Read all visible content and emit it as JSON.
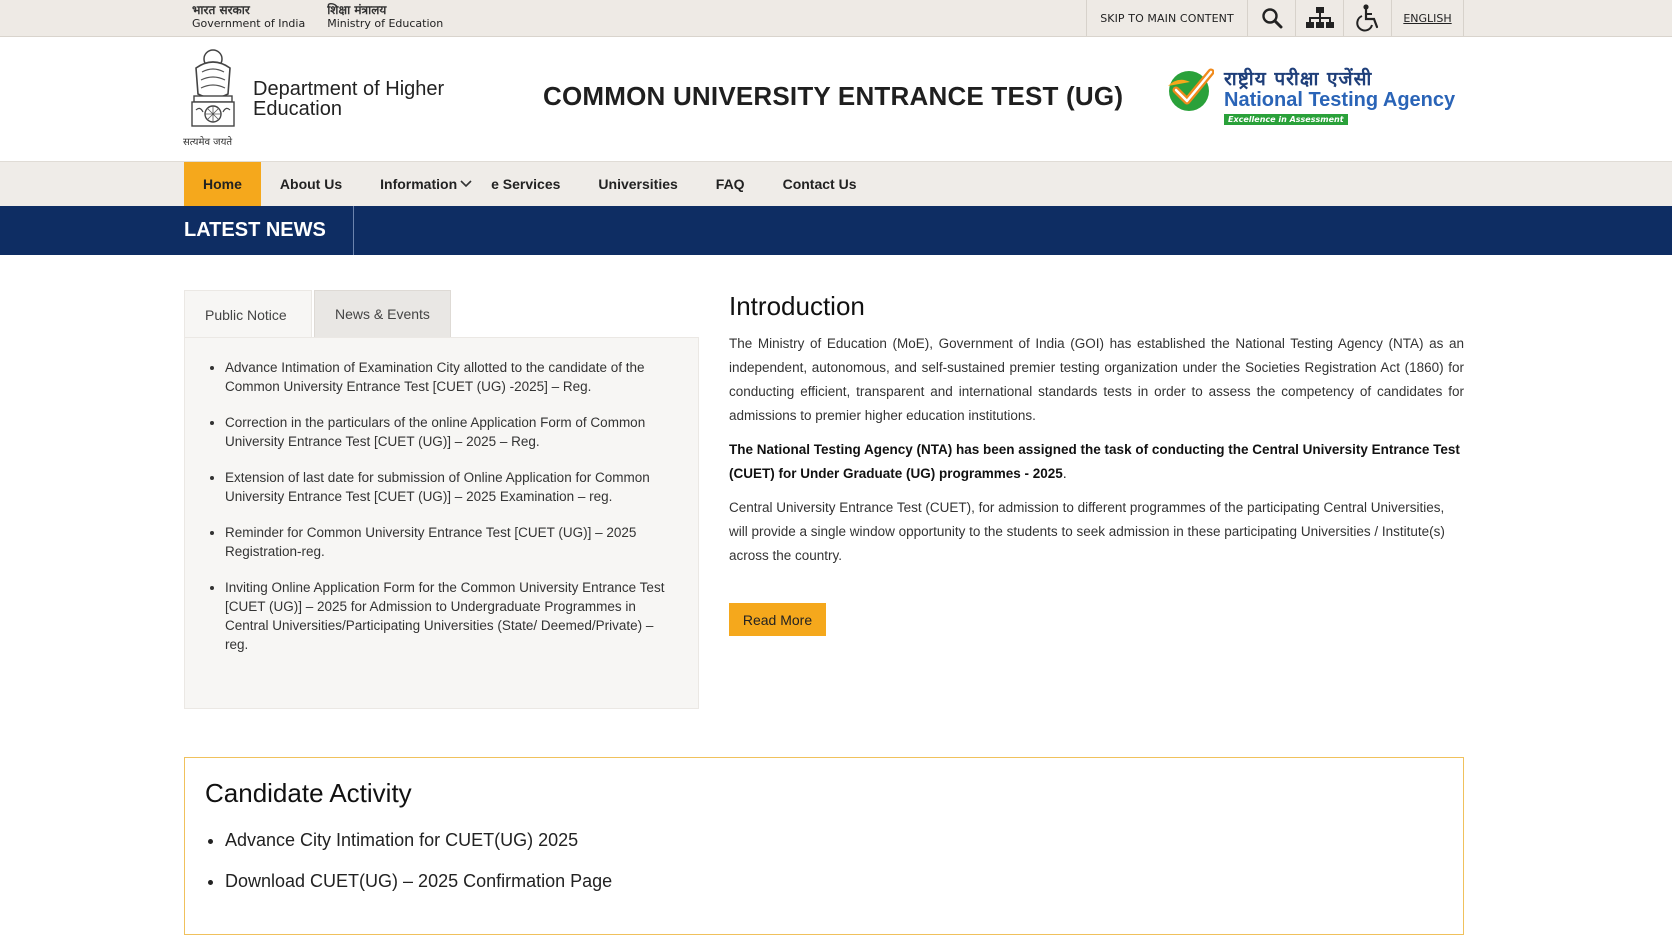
{
  "gov_bar": {
    "gov_hi": "भारत सरकार",
    "gov_en": "Government of India",
    "ministry_hi": "शिक्षा मंत्रालय",
    "ministry_en": "Ministry of Education",
    "skip": "SKIP TO MAIN CONTENT",
    "language": "ENGLISH",
    "icons": [
      "search-icon",
      "sitemap-icon",
      "accessibility-icon"
    ]
  },
  "header": {
    "emblem_caption": "सत्यमेव जयते",
    "department": "Department of Higher Education",
    "title": "COMMON UNIVERSITY ENTRANCE TEST (UG)",
    "nta_hi": "राष्ट्रीय परीक्षा एजेंसी",
    "nta_en": "National Testing Agency",
    "nta_tagline": "Excellence in Assessment"
  },
  "nav": {
    "items": [
      {
        "label": "Home"
      },
      {
        "label": "About Us"
      },
      {
        "label": "Information"
      },
      {
        "label": "e Services"
      },
      {
        "label": "Universities"
      },
      {
        "label": "FAQ"
      },
      {
        "label": "Contact Us"
      }
    ]
  },
  "news_bar": {
    "label": "LATEST NEWS"
  },
  "notices": {
    "tabs": [
      {
        "label": "Public Notice"
      },
      {
        "label": "News & Events"
      }
    ],
    "items": [
      {
        "text": "Advance Intimation of Examination City allotted to the candidate of the Common University Entrance Test [CUET (UG) -2025] – Reg."
      },
      {
        "text": "Correction in the particulars of the online Application Form of Common University Entrance Test [CUET (UG)] – 2025 – Reg."
      },
      {
        "text": "Extension of last date for submission of Online Application for Common University Entrance Test [CUET (UG)] – 2025 Examination – reg."
      },
      {
        "text": "Reminder for Common University Entrance Test [CUET (UG)] – 2025 Registration-reg."
      },
      {
        "text": "Inviting Online Application Form for the Common University Entrance Test [CUET (UG)] – 2025 for Admission to Undergraduate Programmes in Central Universities/Participating Universities (State/ Deemed/Private) – reg."
      }
    ]
  },
  "intro": {
    "heading": "Introduction",
    "p1": "The Ministry of Education (MoE), Government of India (GOI) has established the National Testing Agency (NTA) as an independent, autonomous, and self-sustained premier testing organization under the Societies Registration Act (1860) for conducting efficient, transparent and international standards tests in order to assess the competency of candidates for admissions to premier higher education institutions.",
    "p2_bold": "The National Testing Agency (NTA) has been assigned the task of conducting the Central University Entrance Test (CUET) for Under Graduate (UG) programmes - 2025",
    "p2_end": ".",
    "p3": "Central University Entrance Test (CUET), for admission to different programmes of the participating Central Universities, will provide a single window opportunity to the students to seek admission in these participating Universities / Institute(s) across the country.",
    "read_more": "Read More"
  },
  "candidate_activity": {
    "heading": "Candidate Activity",
    "items": [
      {
        "text": "Advance City Intimation for CUET(UG) 2025"
      },
      {
        "text": "Download CUET(UG) – 2025 Confirmation Page"
      }
    ]
  },
  "colors": {
    "accent": "#f5a81c",
    "news_bar": "#0e2d63",
    "nta_blue": "#2a64b7",
    "nta_green": "#2aa13a"
  }
}
